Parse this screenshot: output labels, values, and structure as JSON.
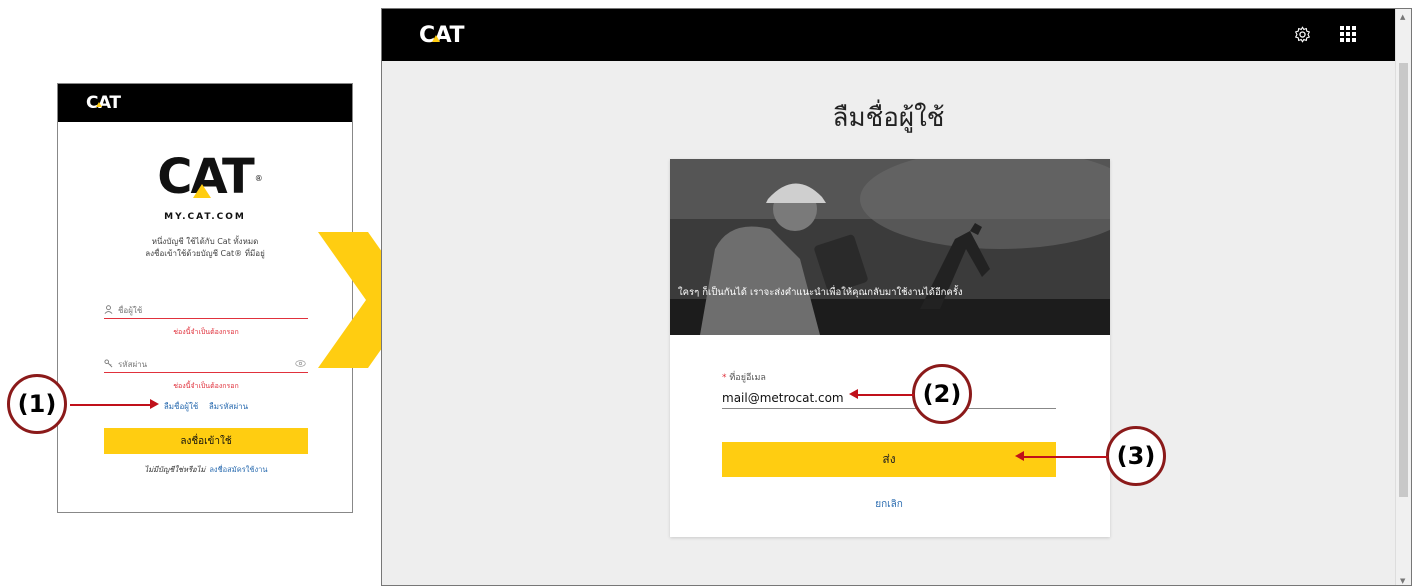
{
  "brand": {
    "wordmark": "CAT",
    "site": "MY.CAT.COM",
    "registered": "®"
  },
  "colors": {
    "accent": "#ffcd11",
    "header": "#000000",
    "error": "#e0313c",
    "link": "#2b6cb0",
    "callout_border": "#8b1a1a",
    "callout_line": "#c0101a"
  },
  "login": {
    "desc_line1": "หนึ่งบัญชี ใช้ได้กับ Cat ทั้งหมด",
    "desc_line2": "ลงชื่อเข้าใช้ด้วยบัญชี Cat® ที่มีอยู่",
    "username_placeholder": "ชื่อผู้ใช้",
    "username_error": "ช่องนี้จำเป็นต้องกรอก",
    "password_placeholder": "รหัสผ่าน",
    "password_error": "ช่องนี้จำเป็นต้องกรอก",
    "forgot_username": "ลืมชื่อผู้ใช้",
    "forgot_password": "ลืมรหัสผ่าน",
    "signin_button": "ลงชื่อเข้าใช้",
    "no_account": "ไม่มีบัญชีใช่หรือไม่",
    "register": "ลงชื่อสมัครใช้งาน"
  },
  "main": {
    "title": "ลืมชื่อผู้ใช้",
    "hero_text": "ใครๆ ก็เป็นกันได้ เราจะส่งคำแนะนำเพื่อให้คุณกลับมาใช้งานได้อีกครั้ง",
    "email_label": "ที่อยู่อีเมล",
    "email_required_mark": "*",
    "email_value": "mail@metrocat.com",
    "send_button": "ส่ง",
    "cancel_link": "ยกเลิก"
  },
  "icons": {
    "user": "user-icon",
    "key": "key-icon",
    "eye": "eye-icon",
    "gear": "gear-icon",
    "apps": "apps-grid-icon"
  },
  "callouts": [
    "(1)",
    "(2)",
    "(3)"
  ]
}
